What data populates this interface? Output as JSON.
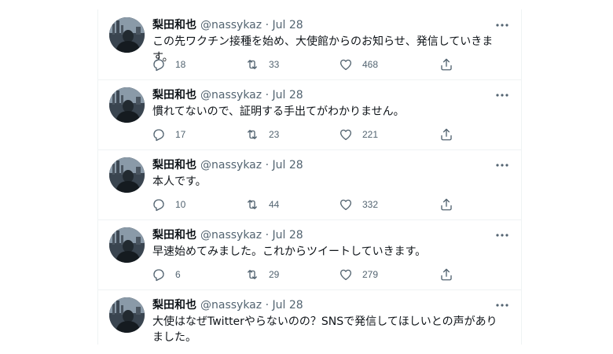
{
  "colors": {
    "text_primary": "#0f1419",
    "text_secondary": "#536471",
    "divider": "#eff3f4"
  },
  "icons": {
    "more": "more-horizontal-icon",
    "reply": "reply-icon",
    "retweet": "retweet-icon",
    "like": "heart-icon",
    "share": "share-icon"
  },
  "tweets": [
    {
      "name": "梨田和也",
      "handle": "@nassykaz",
      "separator": "·",
      "date": "Jul 28",
      "text": "この先ワクチン接種を始め、大使館からのお知らせ、発信していきます。",
      "replies": "18",
      "retweets": "33",
      "likes": "468"
    },
    {
      "name": "梨田和也",
      "handle": "@nassykaz",
      "separator": "·",
      "date": "Jul 28",
      "text": "慣れてないので、証明する手出てがわかりません。",
      "replies": "17",
      "retweets": "23",
      "likes": "221"
    },
    {
      "name": "梨田和也",
      "handle": "@nassykaz",
      "separator": "·",
      "date": "Jul 28",
      "text": "本人です。",
      "replies": "10",
      "retweets": "44",
      "likes": "332"
    },
    {
      "name": "梨田和也",
      "handle": "@nassykaz",
      "separator": "·",
      "date": "Jul 28",
      "text": "早速始めてみました。これからツイートしていきます。",
      "replies": "6",
      "retweets": "29",
      "likes": "279"
    },
    {
      "name": "梨田和也",
      "handle": "@nassykaz",
      "separator": "·",
      "date": "Jul 28",
      "text": "大使はなぜTwitterやらないのの？SNSで発信してほしいとの声がありました。",
      "replies": "",
      "retweets": "",
      "likes": ""
    }
  ]
}
